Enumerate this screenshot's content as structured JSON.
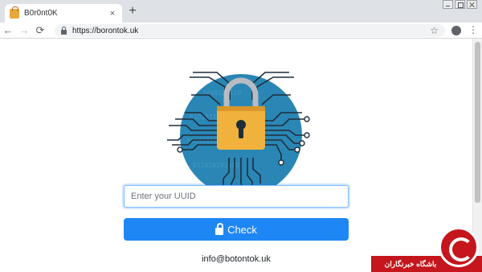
{
  "browser": {
    "tab_title": "B0r0nt0K",
    "tab_close": "×",
    "new_tab": "+",
    "back_icon": "←",
    "forward_icon": "→",
    "reload_icon": "⟳",
    "url": "https://borontok.uk",
    "bookmark_icon": "☆",
    "menu_icon": "⋮"
  },
  "page": {
    "uuid_placeholder": "Enter your UUID",
    "uuid_value": "",
    "check_label": "Check",
    "contact_email": "info@botontok.uk"
  },
  "watermark": {
    "text": "باشگاه خبرنگاران"
  },
  "colors": {
    "button": "#1e86f5",
    "hero_circle": "#2a86b4",
    "padlock": "#f0b23c",
    "watermark": "#c4161c"
  }
}
